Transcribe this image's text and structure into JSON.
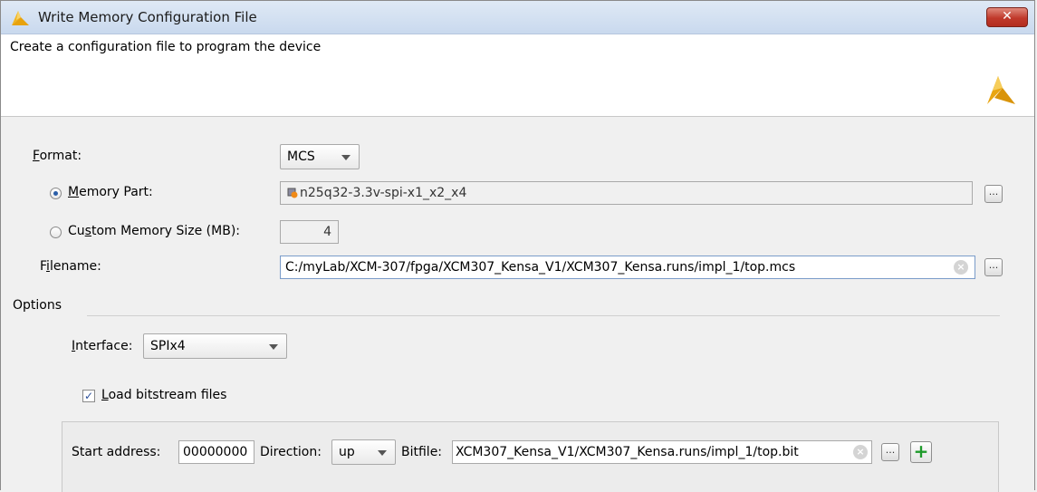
{
  "window": {
    "title": "Write Memory Configuration File",
    "close_label": "✕",
    "description": "Create a configuration file to program the device"
  },
  "format": {
    "label": "Format:",
    "label_hotkey": "F",
    "label_rest": "ormat:",
    "value": "MCS"
  },
  "memory_part": {
    "label_hotkey": "M",
    "label_rest": "emory Part:",
    "selected": true,
    "value": "n25q32-3.3v-spi-x1_x2_x4",
    "browse_label": "..."
  },
  "custom_memory": {
    "label_pre": "Cu",
    "label_hotkey": "s",
    "label_rest": "tom Memory Size (MB):",
    "selected": false,
    "value": "4"
  },
  "filename": {
    "label_pre": "F",
    "label_hotkey": "i",
    "label_rest": "lename:",
    "value": "C:/myLab/XCM-307/fpga/XCM307_Kensa_V1/XCM307_Kensa.runs/impl_1/top.mcs",
    "browse_label": "..."
  },
  "options": {
    "label": "Options",
    "interface": {
      "label_hotkey": "I",
      "label_rest": "nterface:",
      "value": "SPIx4"
    },
    "load_bitstream": {
      "checked": true,
      "check_mark": "✓",
      "label_hotkey": "L",
      "label_rest": "oad bitstream files"
    },
    "bitstream": {
      "start_address_label": "Start address:",
      "start_address": "00000000",
      "direction_label": "Direction:",
      "direction": "up",
      "bitfile_label": "Bitfile:",
      "bitfile": "XCM307_Kensa_V1/XCM307_Kensa.runs/impl_1/top.bit",
      "browse_label": "...",
      "add_label": "+"
    }
  },
  "colors": {
    "accent": "#f0a30a",
    "close_button": "#c0392b",
    "add_icon": "#1e9a2a"
  }
}
